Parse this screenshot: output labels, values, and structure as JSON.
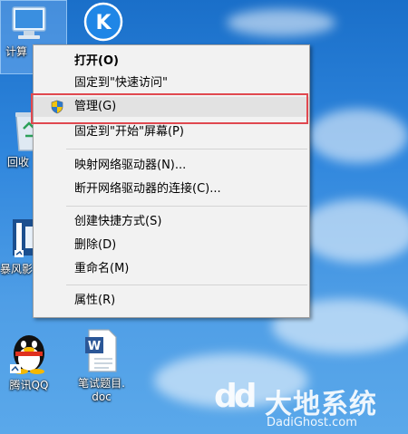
{
  "desktop": {
    "icons": [
      {
        "name": "computer",
        "label": "计算"
      },
      {
        "name": "kugou",
        "label": "K"
      },
      {
        "name": "recycle-bin",
        "label": "回收"
      },
      {
        "name": "baofeng",
        "label": "暴风影"
      },
      {
        "name": "qq",
        "label": "腾讯QQ"
      },
      {
        "name": "word-doc",
        "label": "笔试题目.\ndoc"
      }
    ]
  },
  "context_menu": {
    "items": [
      {
        "label": "打开(O)",
        "bold": true
      },
      {
        "label": "固定到\"快速访问\""
      },
      {
        "label": "管理(G)",
        "highlighted": true,
        "icon": "uac-shield-icon"
      },
      {
        "label": "固定到\"开始\"屏幕(P)"
      },
      {
        "label": "映射网络驱动器(N)..."
      },
      {
        "label": "断开网络驱动器的连接(C)..."
      },
      {
        "label": "创建快捷方式(S)"
      },
      {
        "label": "删除(D)"
      },
      {
        "label": "重命名(M)"
      },
      {
        "label": "属性(R)"
      }
    ]
  },
  "watermark": {
    "logo": "dd",
    "text_cn": "大地系统",
    "text_en": "DadiGhost.com"
  },
  "colors": {
    "highlight_border": "#e0484f",
    "menu_bg": "#f2f2f2"
  }
}
